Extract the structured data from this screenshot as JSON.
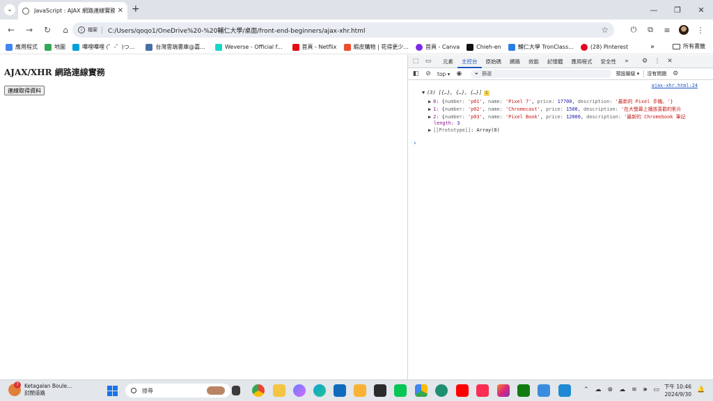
{
  "tab": {
    "title": "JavaScript : AJAX 網路連線實務"
  },
  "omnibox": {
    "label": "檔案",
    "url": "C:/Users/qoqo1/OneDrive%20-%20輔仁大學/桌面/front-end-beginners/ajax-xhr.html"
  },
  "bookmarks": [
    {
      "label": "應用程式",
      "color": "#4285f4"
    },
    {
      "label": "地圖",
      "color": "#34a853"
    },
    {
      "label": "嗶哩嗶哩 (゜-゜)つ...",
      "color": "#00a1d6"
    },
    {
      "label": "台灣雲端書庫@嘉...",
      "color": "#4a6fa5"
    },
    {
      "label": "Weverse - Official f...",
      "color": "#17d8c5"
    },
    {
      "label": "首頁 - Netflix",
      "color": "#e50914"
    },
    {
      "label": "蝦皮購物 | 花得更少...",
      "color": "#ee4d2d"
    },
    {
      "label": "首頁 - Canva",
      "color": "#7d2ae8"
    },
    {
      "label": "Chieh-en",
      "color": "#111111"
    },
    {
      "label": "輔仁大學 TronClass...",
      "color": "#2a7de1"
    },
    {
      "label": "(28) Pinterest",
      "color": "#e60023"
    }
  ],
  "bookmarks_all": "所有書籤",
  "page": {
    "heading": "AJAX/XHR 網路連線實務",
    "button_label": "連線取得資料"
  },
  "devtools": {
    "tabs": [
      "元素",
      "主控台",
      "原始碼",
      "網路",
      "效能",
      "記憶體",
      "應用程式",
      "安全性"
    ],
    "active_tab": "主控台",
    "context": "top",
    "filter_placeholder": "篩選",
    "levels": "預設層級",
    "issues": "沒有問題",
    "source_link": "ajax-xhr.html:24",
    "summary": "(3) [{…}, {…}, {…}]",
    "info_count": "i",
    "items": [
      {
        "index": "0",
        "number": "'p01'",
        "name": "'Pixel 7'",
        "price": "17700",
        "description": "'最新的 Pixel 手機。'}"
      },
      {
        "index": "1",
        "number": "'p02'",
        "name": "'Chromecast'",
        "price": "1500",
        "description": "'在大螢幕上播放喜歡的影片"
      },
      {
        "index": "2",
        "number": "'p03'",
        "name": "'Pixel Book'",
        "price": "12000",
        "description": "'最新的 Chromebook 筆記"
      }
    ],
    "length_label": "length",
    "length_value": "3",
    "prototype_label": "[[Prototype]]",
    "prototype_value": "Array(0)"
  },
  "taskbar": {
    "weather_title": "Ketagalan Boule...",
    "weather_sub": "封閉道路",
    "weather_badge": "7",
    "search_placeholder": "搜尋",
    "time": "下午 10:46",
    "date": "2024/9/30"
  }
}
